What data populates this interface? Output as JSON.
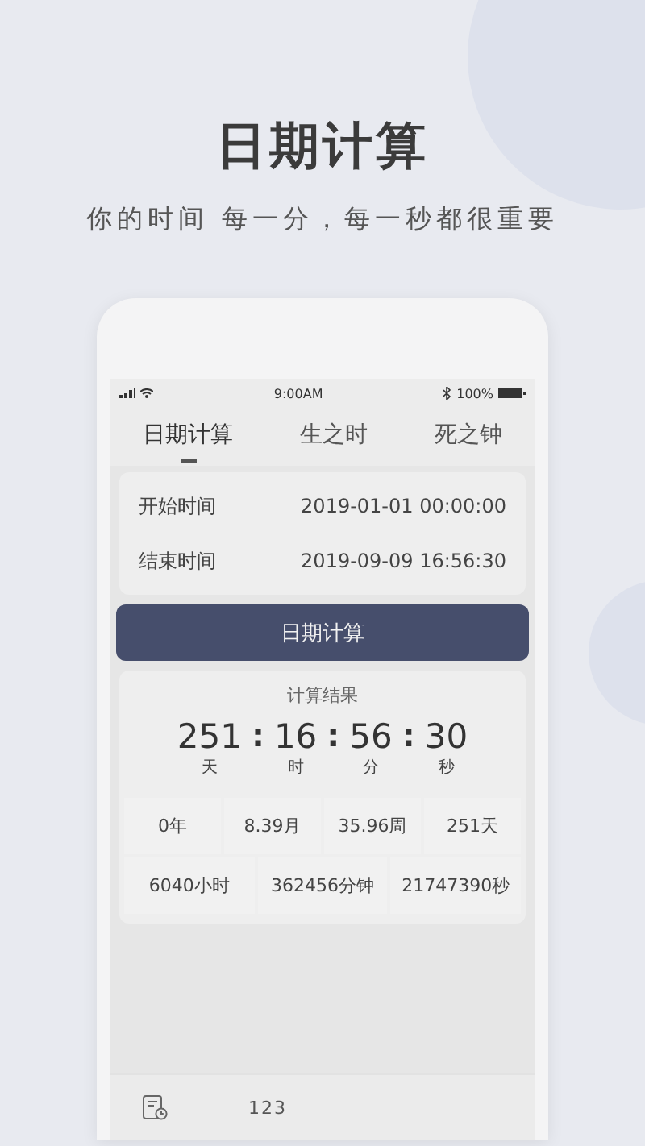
{
  "header": {
    "title": "日期计算",
    "subtitle": "你的时间 每一分，每一秒都很重要"
  },
  "status_bar": {
    "time": "9:00AM",
    "battery": "100%"
  },
  "tabs": [
    {
      "label": "日期计算",
      "selected": true
    },
    {
      "label": "生之时",
      "selected": false
    },
    {
      "label": "死之钟",
      "selected": false
    }
  ],
  "inputs": [
    {
      "label": "开始时间",
      "value": "2019-01-01 00:00:00"
    },
    {
      "label": "结束时间",
      "value": "2019-09-09 16:56:30"
    }
  ],
  "calc_button": "日期计算",
  "result": {
    "title": "计算结果",
    "separator": ":",
    "units": [
      {
        "value": "251",
        "unit": "天"
      },
      {
        "value": "16",
        "unit": "时"
      },
      {
        "value": "56",
        "unit": "分"
      },
      {
        "value": "30",
        "unit": "秒"
      }
    ],
    "stats_rows": [
      [
        "0年",
        "8.39月",
        "35.96周",
        "251天"
      ],
      [
        "6040小时",
        "362456分钟",
        "21747390秒"
      ]
    ]
  },
  "bottom_bar": {
    "label": "123"
  }
}
